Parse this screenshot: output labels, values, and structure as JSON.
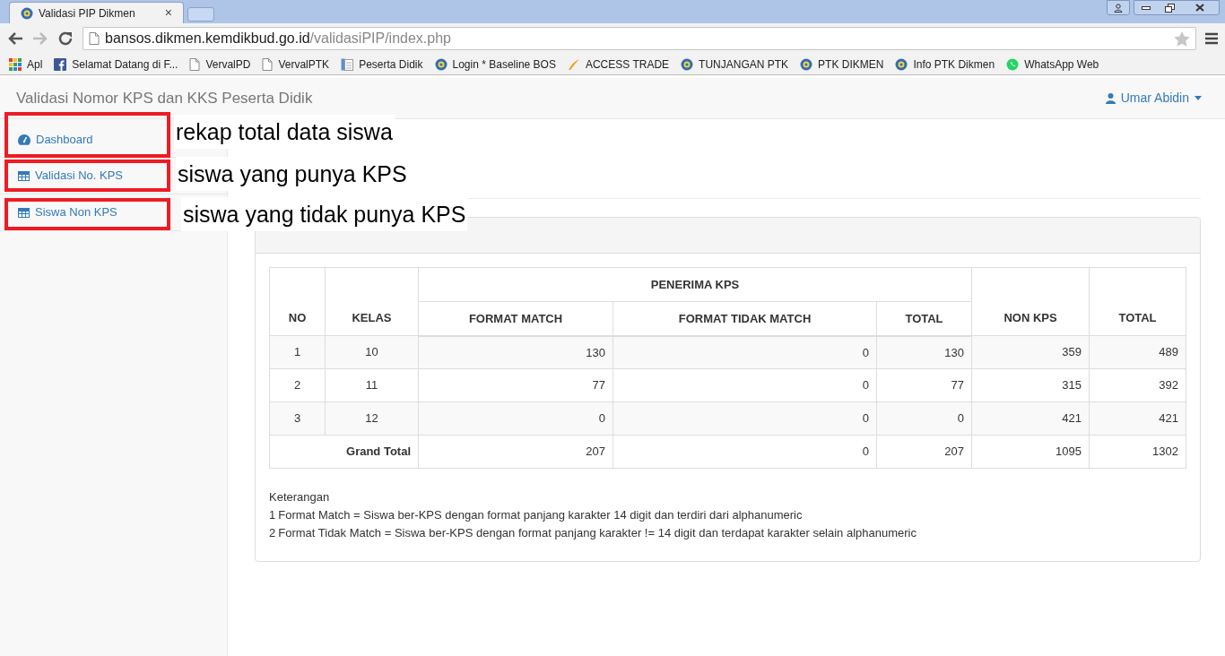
{
  "browser": {
    "tab_title": "Validasi PIP Dikmen",
    "tab_close": "×",
    "url_host": "bansos.dikmen.kemdikbud.go.id",
    "url_path": "/validasiPIP/index.php",
    "bookmarks": [
      {
        "kind": "apps",
        "label": "Apl"
      },
      {
        "kind": "facebook",
        "label": "Selamat Datang di F..."
      },
      {
        "kind": "page",
        "label": "VervalPD"
      },
      {
        "kind": "page",
        "label": "VervalPTK"
      },
      {
        "kind": "doc",
        "label": "Peserta Didik"
      },
      {
        "kind": "emblem",
        "label": "Login * Baseline BOS"
      },
      {
        "kind": "trade",
        "label": "ACCESS TRADE"
      },
      {
        "kind": "emblem",
        "label": "TUNJANGAN PTK"
      },
      {
        "kind": "emblem",
        "label": "PTK DIKMEN"
      },
      {
        "kind": "emblem",
        "label": "Info PTK Dikmen"
      },
      {
        "kind": "whatsapp",
        "label": "WhatsApp Web"
      }
    ]
  },
  "navbar": {
    "brand": "Validasi Nomor KPS dan KKS Peserta Didik",
    "user": "Umar Abidin"
  },
  "sidebar": {
    "items": [
      {
        "kind": "gauge",
        "label": "Dashboard"
      },
      {
        "kind": "table",
        "label": "Validasi No. KPS"
      },
      {
        "kind": "table",
        "label": "Siswa Non KPS"
      }
    ]
  },
  "annotations": [
    "rekap total data siswa",
    "siswa yang punya KPS",
    "siswa yang tidak punya KPS"
  ],
  "table": {
    "col_no": "NO",
    "col_kelas": "KELAS",
    "group": "PENERIMA KPS",
    "sub_columns": [
      "FORMAT MATCH",
      "FORMAT TIDAK MATCH",
      "TOTAL"
    ],
    "col_non_kps": "NON KPS",
    "col_total": "TOTAL",
    "rows": [
      [
        "1",
        "10",
        "130",
        "0",
        "130",
        "359",
        "489"
      ],
      [
        "2",
        "11",
        "77",
        "0",
        "77",
        "315",
        "392"
      ],
      [
        "3",
        "12",
        "0",
        "0",
        "0",
        "421",
        "421"
      ]
    ],
    "grand_total": {
      "label": "Grand Total",
      "values": [
        "207",
        "0",
        "207",
        "1095",
        "1302"
      ]
    }
  },
  "notes": {
    "title": "Keterangan",
    "lines": [
      {
        "number": "1",
        "text": "Format Match = Siswa ber-KPS dengan format panjang karakter 14 digit dan terdiri dari alphanumeric"
      },
      {
        "number": "2",
        "text": "Format Tidak Match = Siswa ber-KPS dengan format panjang karakter != 14 digit dan terdapat karakter selain alphanumeric"
      }
    ]
  }
}
